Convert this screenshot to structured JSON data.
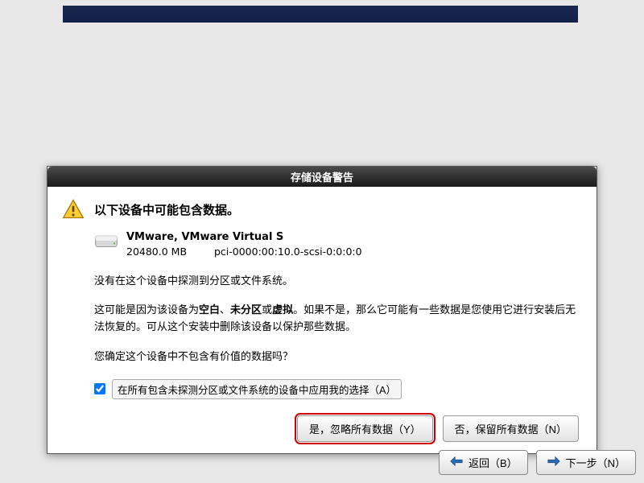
{
  "dialog": {
    "title": "存储设备警告",
    "heading": "以下设备中可能包含数据。",
    "device": {
      "name": "VMware, VMware Virtual S",
      "size": "20480.0 MB",
      "path": "pci-0000:00:10.0-scsi-0:0:0:0"
    },
    "line1": "没有在这个设备中探测到分区或文件系统。",
    "para2_pre": "这可能是因为该设备为",
    "para2_b1": "空白",
    "para2_sep1": "、",
    "para2_b2": "未分区",
    "para2_sep2": "或",
    "para2_b3": "虚拟",
    "para2_post": "。如果不是，那么它可能有一些数据是您使用它进行安装后无法恢复的。可从这个安装中删除该设备以保护那些数据。",
    "line3": "您确定这个设备中不包含有价值的数据吗？",
    "checkbox_label": "在所有包含未探测分区或文件系统的设备中应用我的选择（A）",
    "btn_yes": "是，忽略所有数据（Y）",
    "btn_no": "否，保留所有数据（N）"
  },
  "nav": {
    "back": "返回（B）",
    "next": "下一步（N）"
  }
}
